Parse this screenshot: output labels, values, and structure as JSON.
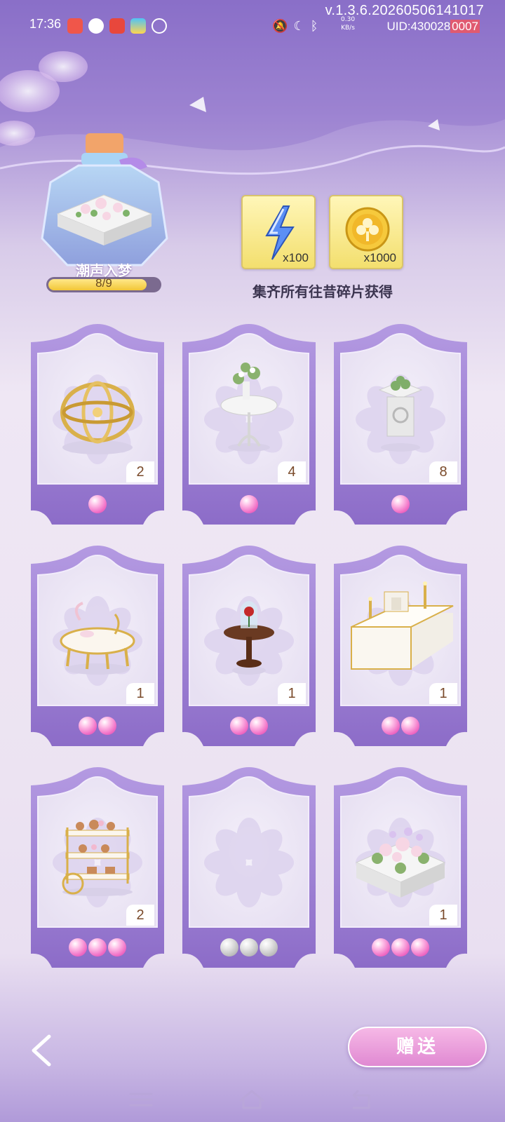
{
  "status_bar": {
    "time": "17:36",
    "version": "v.1.3.6.20260506141017",
    "uid": "UID:430028",
    "uid_suffix": "0007",
    "speed_top": "0.30",
    "speed_bottom": "KB/s"
  },
  "collection": {
    "name": "潮声入梦",
    "progress_text": "8/9",
    "progress_fraction": 0.889
  },
  "rewards": [
    {
      "icon": "lightning-icon",
      "count": "x100"
    },
    {
      "icon": "clover-coin-icon",
      "count": "x1000"
    }
  ],
  "reward_description": "集齐所有往昔碎片获得",
  "cards": [
    {
      "item": "armillary-sphere",
      "count": "2",
      "gems": 1,
      "gem_color": "pink"
    },
    {
      "item": "flower-table",
      "count": "4",
      "gems": 1,
      "gem_color": "pink"
    },
    {
      "item": "planter-stand",
      "count": "8",
      "gems": 1,
      "gem_color": "pink"
    },
    {
      "item": "tea-table",
      "count": "1",
      "gems": 2,
      "gem_color": "pink"
    },
    {
      "item": "rose-dome-table",
      "count": "1",
      "gems": 2,
      "gem_color": "pink"
    },
    {
      "item": "fireplace",
      "count": "1",
      "gems": 2,
      "gem_color": "pink"
    },
    {
      "item": "dessert-cart",
      "count": "2",
      "gems": 3,
      "gem_color": "pink"
    },
    {
      "item": "empty-slot",
      "count": "",
      "gems": 3,
      "gem_color": "gray"
    },
    {
      "item": "flower-planter-box",
      "count": "1",
      "gems": 3,
      "gem_color": "pink"
    }
  ],
  "buttons": {
    "gift_label": "赠送"
  },
  "colors": {
    "frame_purple": "#9a7cd4",
    "gem_pink": "#f06ac4",
    "gift_button": "#e089d2"
  }
}
